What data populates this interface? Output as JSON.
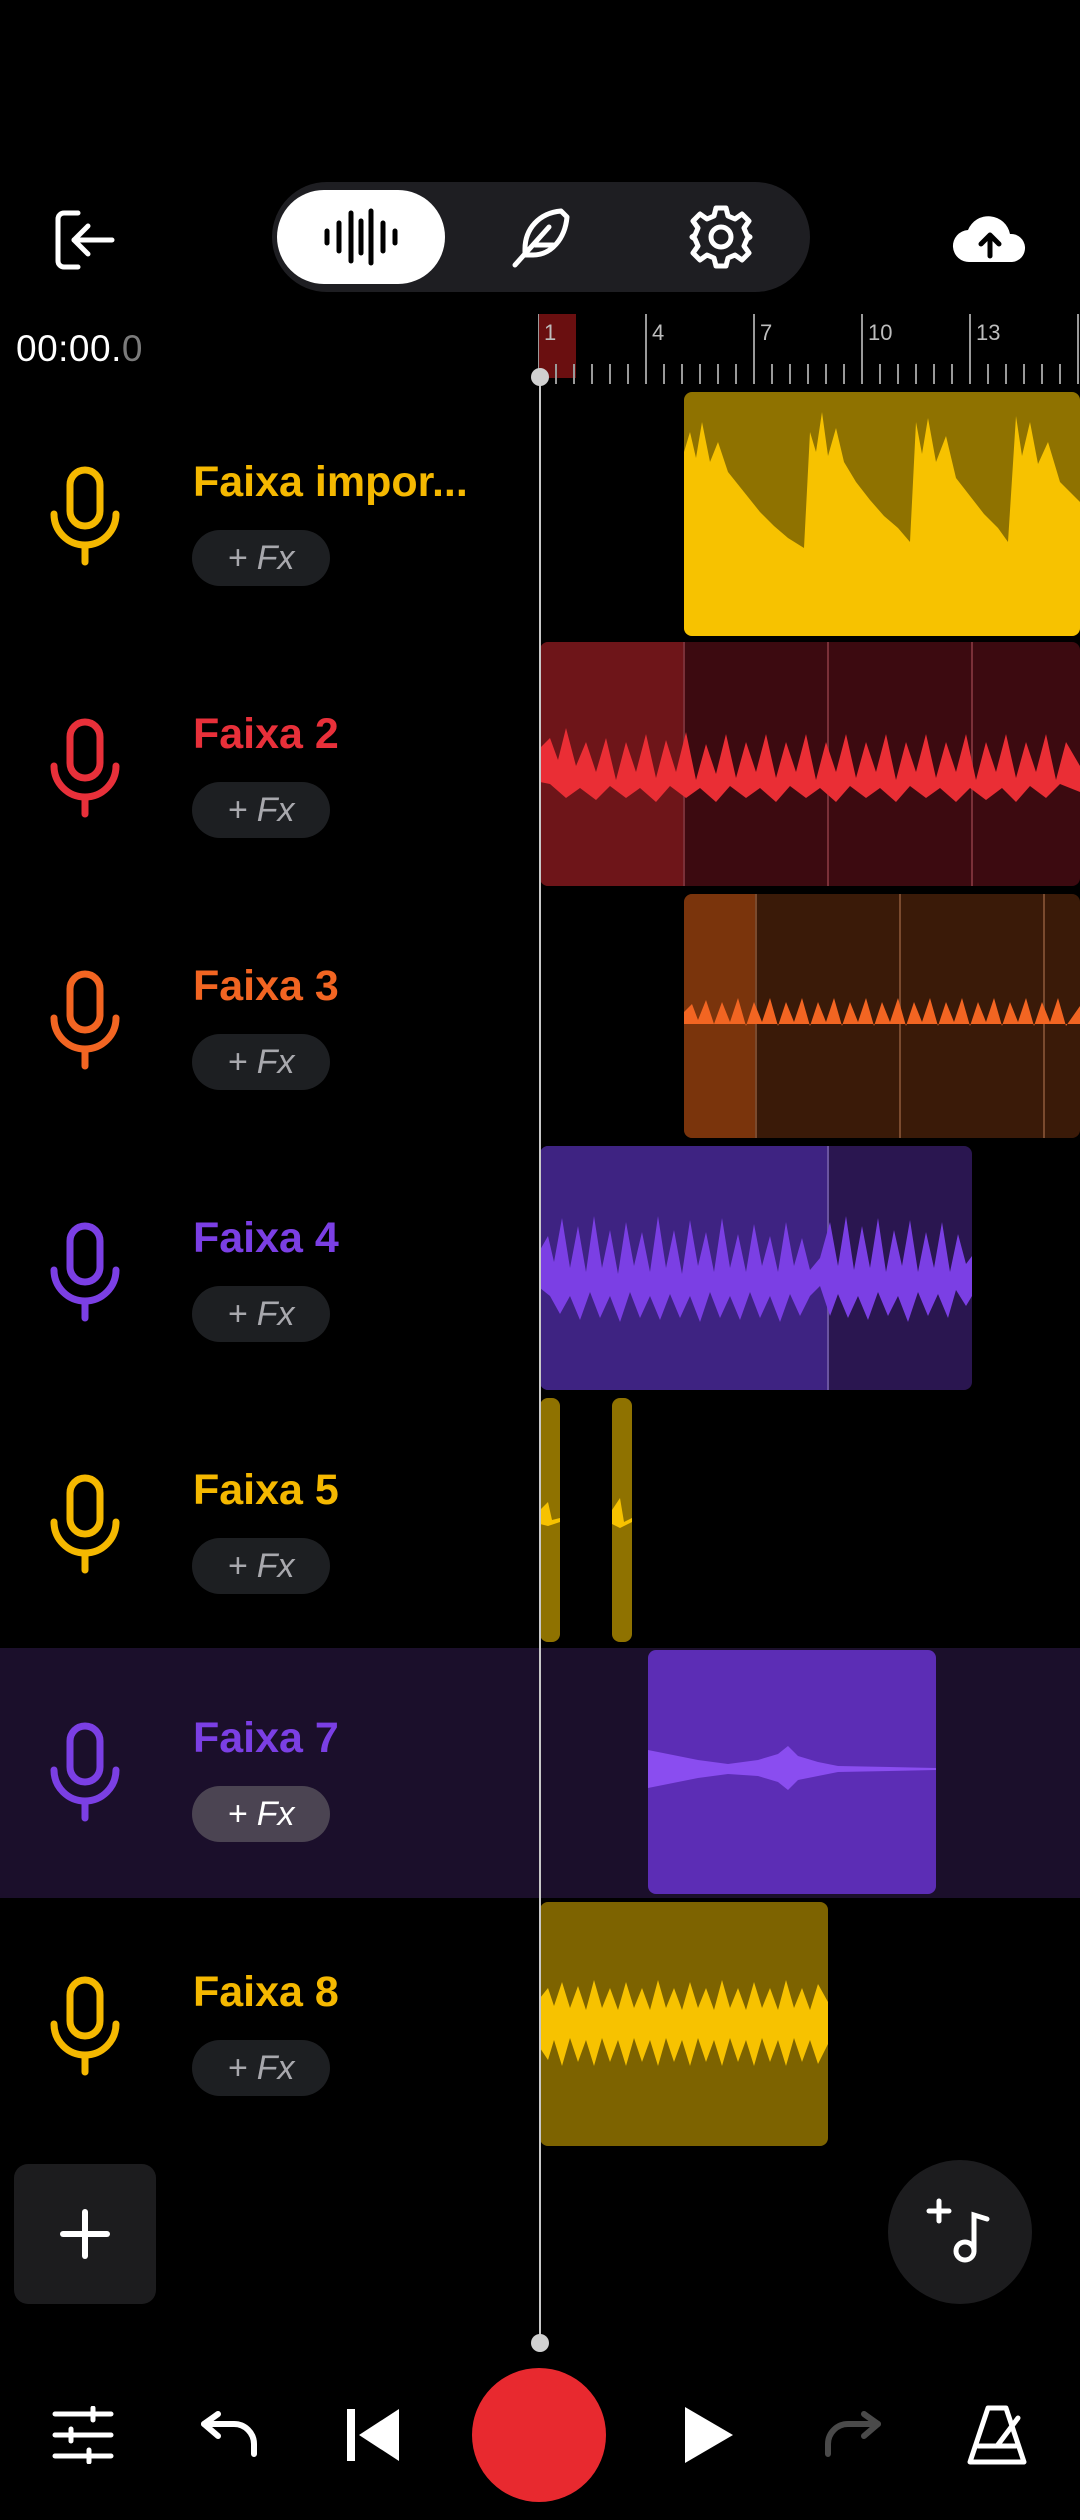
{
  "app": {
    "time": {
      "main": "00:00.",
      "fraction": "0"
    },
    "ruler": {
      "marks": [
        "1",
        "4",
        "7",
        "10",
        "13"
      ]
    },
    "top_tabs": [
      {
        "name": "waveform",
        "icon": "waveform-icon",
        "selected": true
      },
      {
        "name": "effects",
        "icon": "feather-icon",
        "selected": false
      },
      {
        "name": "settings",
        "icon": "gear-icon",
        "selected": false
      }
    ]
  },
  "tracks": [
    {
      "name": "Faixa impor...",
      "fx": "+ Fx",
      "color": "#f5b800",
      "selected": false
    },
    {
      "name": "Faixa 2",
      "fx": "+ Fx",
      "color": "#e8303a",
      "selected": false
    },
    {
      "name": "Faixa 3",
      "fx": "+ Fx",
      "color": "#f26522",
      "selected": false
    },
    {
      "name": "Faixa 4",
      "fx": "+ Fx",
      "color": "#7b3fe4",
      "selected": false
    },
    {
      "name": "Faixa 5",
      "fx": "+ Fx",
      "color": "#f5b800",
      "selected": false
    },
    {
      "name": "Faixa 7",
      "fx": "+ Fx",
      "color": "#7b3fe4",
      "selected": true
    },
    {
      "name": "Faixa 8",
      "fx": "+ Fx",
      "color": "#f5b800",
      "selected": false
    }
  ],
  "colors": {
    "record": "#e8292f",
    "selected_row": "#1b0f2b"
  },
  "bottom_bar": {
    "icons": [
      "mixer-icon",
      "undo-icon",
      "skip-back-icon",
      "record-icon",
      "play-icon",
      "redo-icon",
      "metronome-icon"
    ]
  }
}
